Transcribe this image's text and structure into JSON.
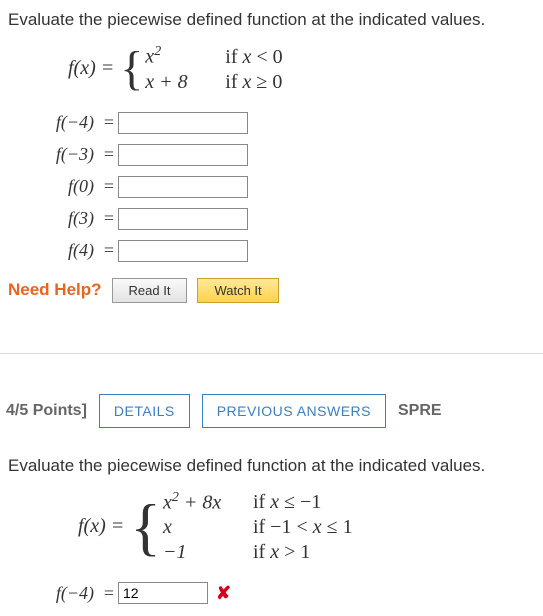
{
  "q1": {
    "prompt": "Evaluate the piecewise defined function at the indicated values.",
    "func_label": "f(x) = ",
    "pieces": [
      {
        "expr_html": "x<sup>2</sup>",
        "cond_html": "if <span class='var'>x</span> &lt; 0"
      },
      {
        "expr_html": "x + 8",
        "cond_html": "if <span class='var'>x</span> &ge; 0"
      }
    ],
    "rows": [
      {
        "label": "f(−4)",
        "value": ""
      },
      {
        "label": "f(−3)",
        "value": ""
      },
      {
        "label": "f(0)",
        "value": ""
      },
      {
        "label": "f(3)",
        "value": ""
      },
      {
        "label": "f(4)",
        "value": ""
      }
    ],
    "eq": "=",
    "need_help": "Need Help?",
    "read_it": "Read It",
    "watch_it": "Watch It"
  },
  "header": {
    "points": "4/5 Points]",
    "details": "DETAILS",
    "prev": "PREVIOUS ANSWERS",
    "spre": "SPRE"
  },
  "q2": {
    "prompt": "Evaluate the piecewise defined function at the indicated values.",
    "func_label": "f(x) = ",
    "pieces": [
      {
        "expr_html": "x<sup>2</sup> + 8x",
        "cond_html": "if <span class='var'>x</span> &le; &minus;1"
      },
      {
        "expr_html": "x",
        "cond_html": "if &minus;1 &lt; <span class='var'>x</span> &le; 1"
      },
      {
        "expr_html": "−1",
        "cond_html": "if <span class='var'>x</span> &gt; 1"
      }
    ],
    "rows": [
      {
        "label": "f(−4)",
        "value": "12",
        "mark": "✘"
      }
    ],
    "eq": "="
  }
}
